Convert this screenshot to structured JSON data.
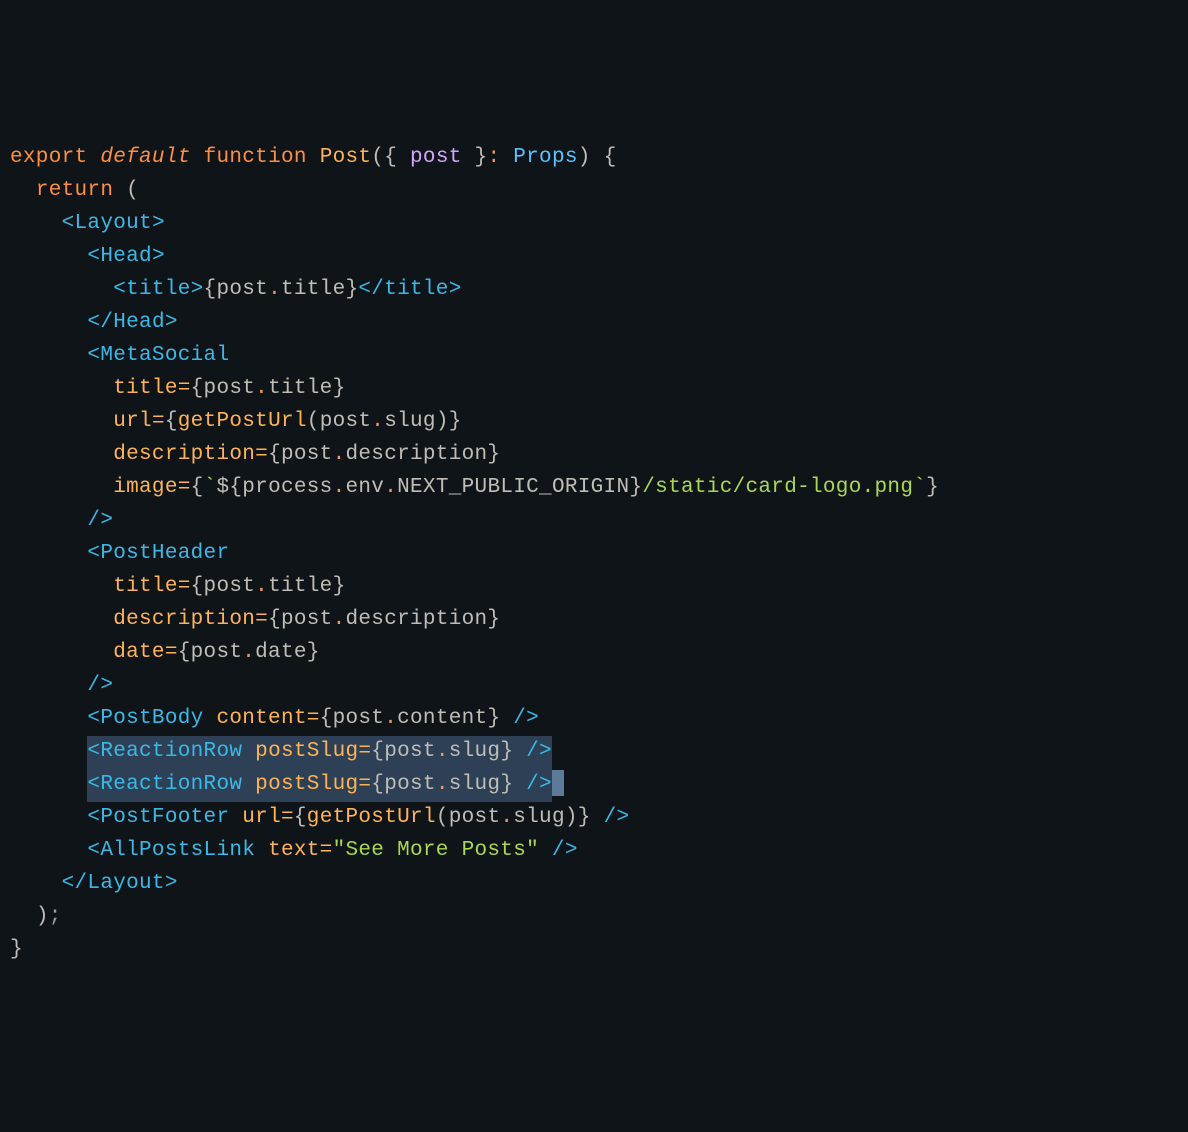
{
  "code": {
    "l1": {
      "export": "export",
      "default": "default",
      "function": "function",
      "name": "Post",
      "param": "post",
      "type": "Props"
    },
    "l2": {
      "return": "return"
    },
    "l3": {
      "tag": "Layout"
    },
    "l4": {
      "tag": "Head"
    },
    "l5": {
      "tag": "title",
      "prop1": "post",
      "prop2": "title"
    },
    "l6": {
      "tag": "Head"
    },
    "l7": {
      "tag": "MetaSocial"
    },
    "l8": {
      "attr": "title",
      "prop1": "post",
      "prop2": "title"
    },
    "l9": {
      "attr": "url",
      "fn": "getPostUrl",
      "prop1": "post",
      "prop2": "slug"
    },
    "l10": {
      "attr": "description",
      "prop1": "post",
      "prop2": "description"
    },
    "l11": {
      "attr": "image",
      "p1": "process",
      "p2": "env",
      "p3": "NEXT_PUBLIC_ORIGIN",
      "rest": "/static/card-logo.png"
    },
    "l13": {
      "tag": "PostHeader"
    },
    "l14": {
      "attr": "title",
      "prop1": "post",
      "prop2": "title"
    },
    "l15": {
      "attr": "description",
      "prop1": "post",
      "prop2": "description"
    },
    "l16": {
      "attr": "date",
      "prop1": "post",
      "prop2": "date"
    },
    "l18": {
      "tag": "PostBody",
      "attr": "content",
      "prop1": "post",
      "prop2": "content"
    },
    "l19": {
      "tag": "ReactionRow",
      "attr": "postSlug",
      "prop1": "post",
      "prop2": "slug"
    },
    "l20": {
      "tag": "ReactionRow",
      "attr": "postSlug",
      "prop1": "post",
      "prop2": "slug"
    },
    "l21": {
      "tag": "PostFooter",
      "attr": "url",
      "fn": "getPostUrl",
      "prop1": "post",
      "prop2": "slug"
    },
    "l22": {
      "tag": "AllPostsLink",
      "attr": "text",
      "val": "\"See More Posts\""
    },
    "l23": {
      "tag": "Layout"
    }
  }
}
